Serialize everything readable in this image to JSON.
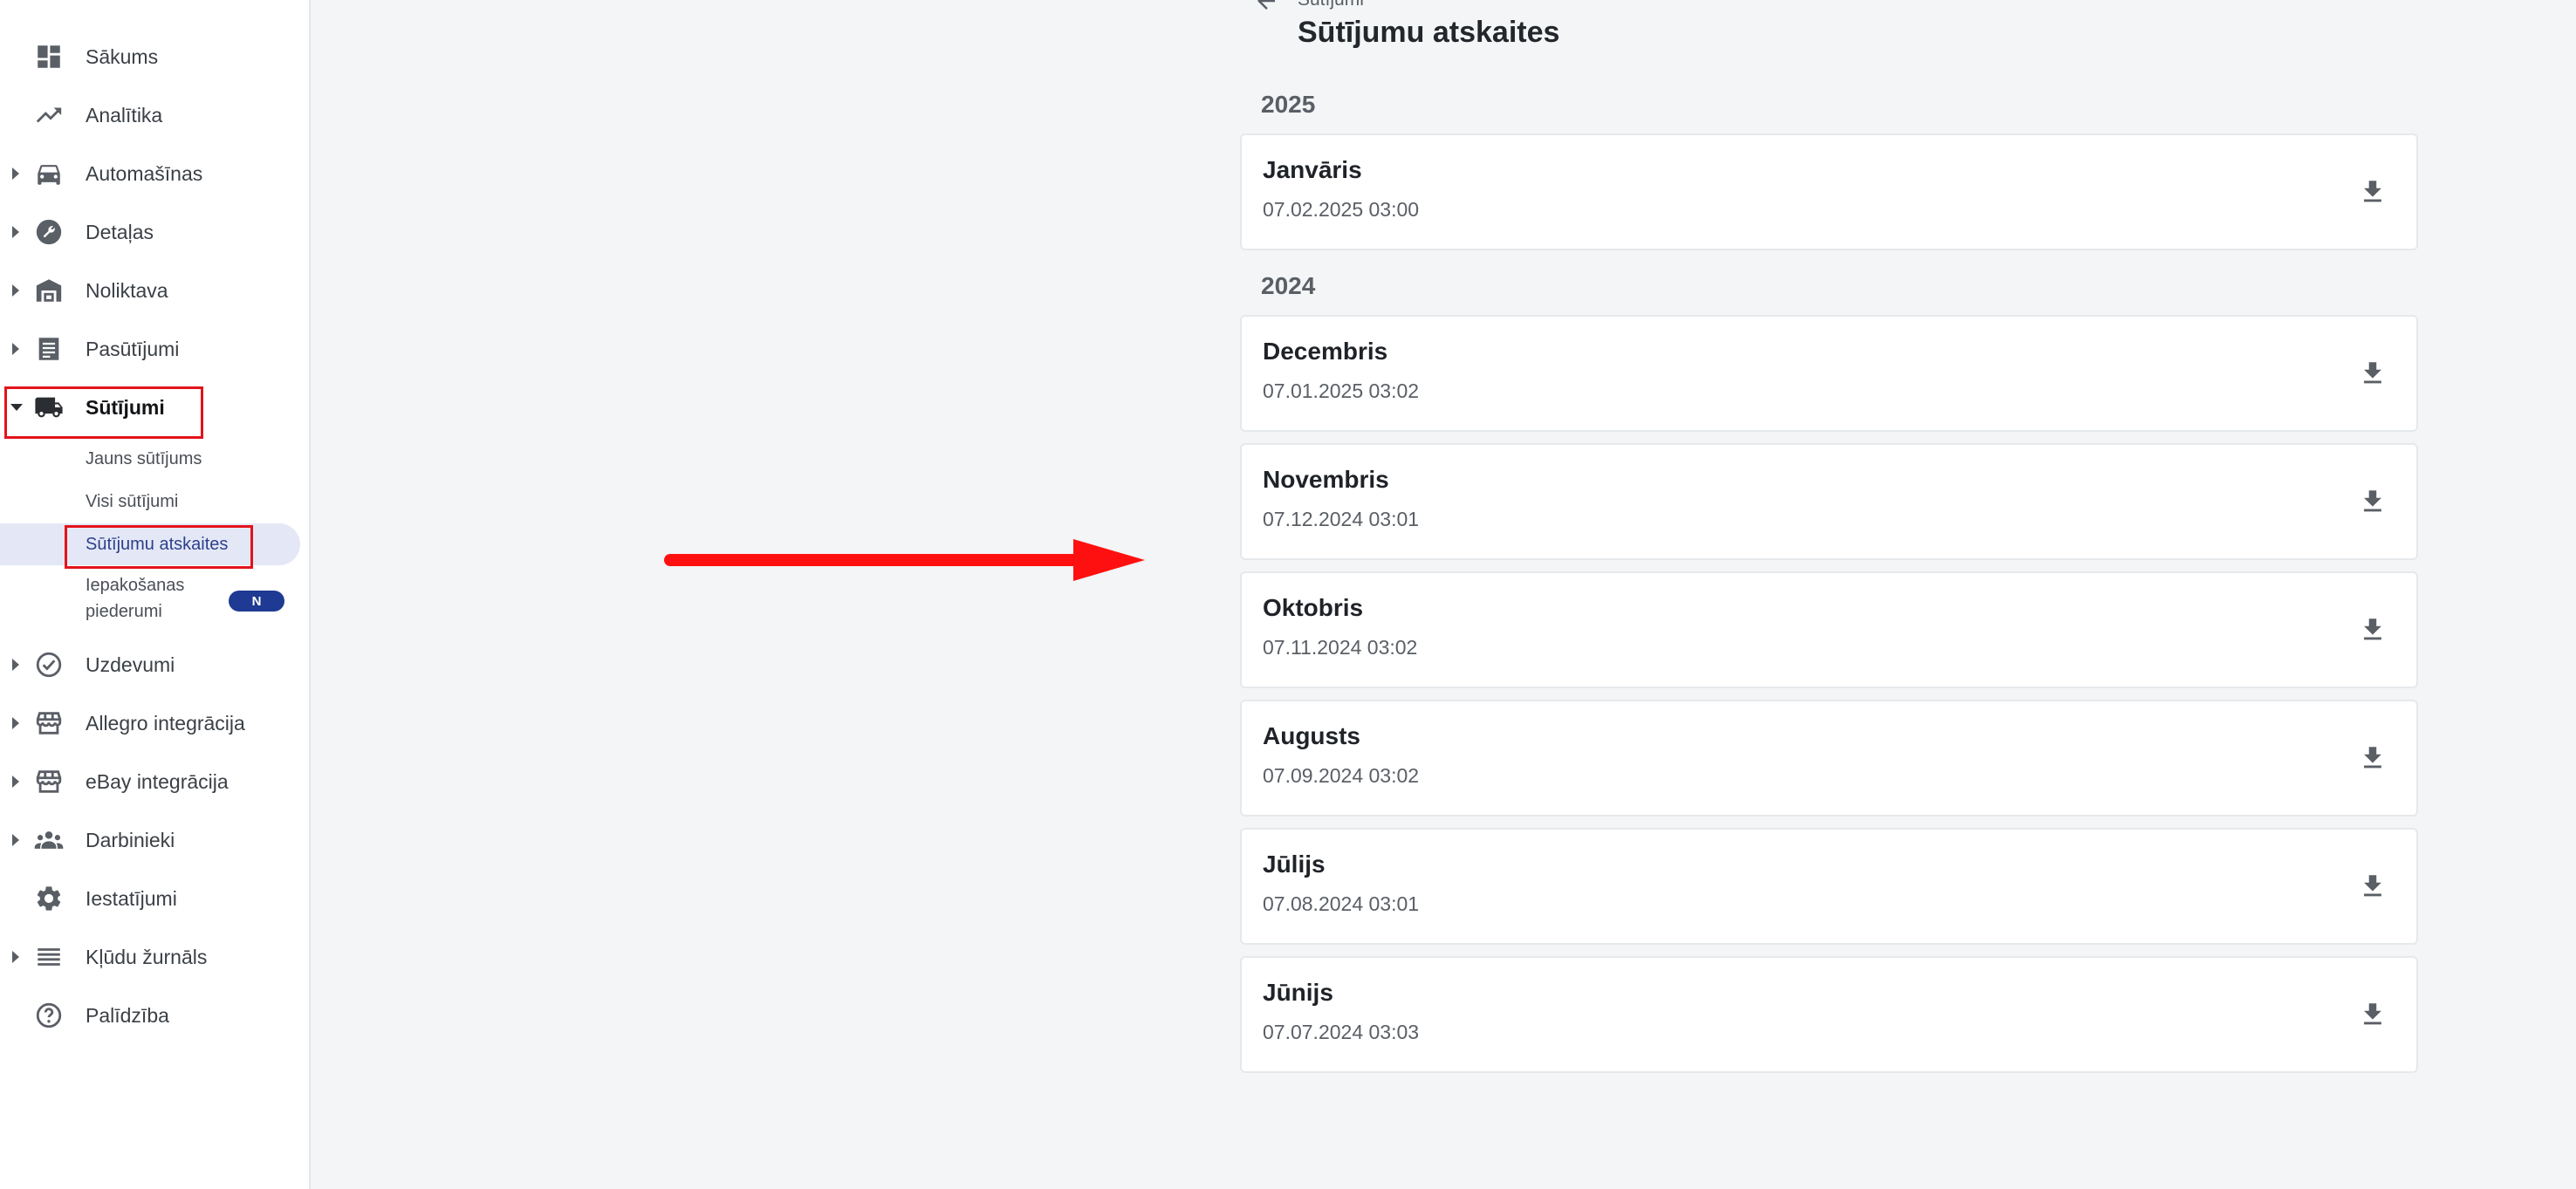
{
  "colors": {
    "accent": "#1f3a93",
    "highlight": "#e3131b",
    "selected_bg": "#e4e8f6"
  },
  "sidebar": {
    "items": [
      {
        "label": "Sākums",
        "icon": "dashboard-icon",
        "expandable": false
      },
      {
        "label": "Analītika",
        "icon": "trending-up-icon",
        "expandable": false
      },
      {
        "label": "Automašīnas",
        "icon": "car-icon",
        "expandable": true
      },
      {
        "label": "Detaļas",
        "icon": "wrench-icon",
        "expandable": true
      },
      {
        "label": "Noliktava",
        "icon": "warehouse-icon",
        "expandable": true
      },
      {
        "label": "Pasūtījumi",
        "icon": "receipt-icon",
        "expandable": true
      },
      {
        "label": "Sūtījumi",
        "icon": "truck-icon",
        "expandable": true,
        "expanded": true,
        "active": true
      },
      {
        "label": "Uzdevumi",
        "icon": "check-circle-icon",
        "expandable": true
      },
      {
        "label": "Allegro integrācija",
        "icon": "store-icon",
        "expandable": true
      },
      {
        "label": "eBay integrācija",
        "icon": "store-icon",
        "expandable": true
      },
      {
        "label": "Darbinieki",
        "icon": "people-icon",
        "expandable": true
      },
      {
        "label": "Iestatījumi",
        "icon": "gear-icon",
        "expandable": false
      },
      {
        "label": "Kļūdu žurnāls",
        "icon": "list-icon",
        "expandable": true
      },
      {
        "label": "Palīdzība",
        "icon": "help-icon",
        "expandable": false
      }
    ],
    "sub_items": [
      {
        "label": "Jauns sūtījums"
      },
      {
        "label": "Visi sūtījumi"
      },
      {
        "label": "Sūtījumu atskaites",
        "selected": true
      },
      {
        "label": "Iepakošanas piederumi",
        "badge": "N"
      }
    ]
  },
  "main": {
    "breadcrumb": "Sūtījumi",
    "title": "Sūtījumu atskaites",
    "groups": [
      {
        "year": "2025",
        "reports": [
          {
            "month": "Janvāris",
            "date": "07.02.2025 03:00"
          }
        ]
      },
      {
        "year": "2024",
        "reports": [
          {
            "month": "Decembris",
            "date": "07.01.2025 03:02"
          },
          {
            "month": "Novembris",
            "date": "07.12.2024 03:01"
          },
          {
            "month": "Oktobris",
            "date": "07.11.2024 03:02"
          },
          {
            "month": "Augusts",
            "date": "07.09.2024 03:02"
          },
          {
            "month": "Jūlijs",
            "date": "07.08.2024 03:01"
          },
          {
            "month": "Jūnijs",
            "date": "07.07.2024 03:03"
          }
        ]
      }
    ]
  }
}
